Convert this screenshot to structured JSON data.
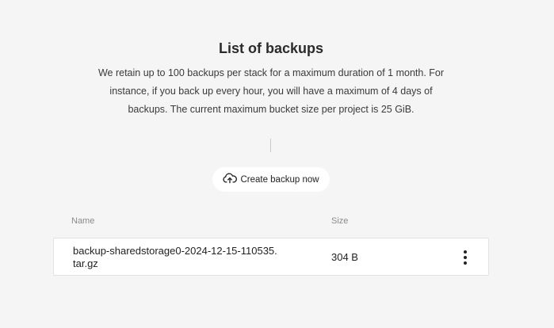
{
  "header": {
    "title": "List of backups",
    "description": "We retain up to 100 backups per stack for a maximum duration of 1 month. For instance, if you back up every hour, you will have a maximum of 4 days of backups. The current maximum bucket size per project is 25 GiB."
  },
  "actions": {
    "create_label": "Create backup now",
    "create_icon": "cloud-upload-icon"
  },
  "table": {
    "columns": [
      "Name",
      "Size"
    ],
    "rows": [
      {
        "name": "backup-sharedstorage0-2024-12-15-110535.tar.gz",
        "size": "304 B"
      }
    ],
    "row_menu_icon": "more-vertical-icon"
  }
}
